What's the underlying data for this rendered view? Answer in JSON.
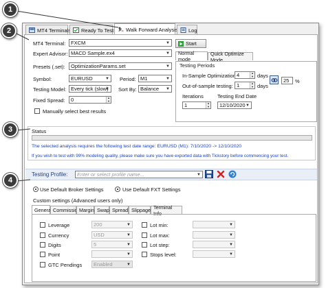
{
  "callouts": [
    "1",
    "2",
    "3",
    "4"
  ],
  "tabs": [
    {
      "label": "MT4 Terminals",
      "icon": "terminal-icon"
    },
    {
      "label": "Ready To Test",
      "icon": "checklist-icon"
    },
    {
      "label": "Walk Forward Analysis",
      "icon": "walk-forward-icon"
    },
    {
      "label": "Log",
      "icon": "log-icon"
    }
  ],
  "settings": {
    "terminal_label": "MT4 Terminal:",
    "terminal_value": "FXCM",
    "ea_label": "Expert Advisor:",
    "ea_value": "MACD Sample.ex4",
    "presets_label": "Presets (.set):",
    "presets_value": "OptimizationParams.set",
    "symbol_label": "Symbol:",
    "symbol_value": "EURUSD",
    "period_label": "Period:",
    "period_value": "M1",
    "model_label": "Testing Model:",
    "model_value": "Every tick (slow)",
    "sortby_label": "Sort By:",
    "sortby_value": "Balance",
    "spread_label": "Fixed Spread:",
    "spread_value": "0",
    "manual_label": "Manually select best results",
    "start_label": "Start"
  },
  "periods": {
    "normal_tab": "Normal mode",
    "quick_tab": "Quick Optimize Mode",
    "group_title": "Testing Periods",
    "insample_label": "In-Sample Optimization:",
    "insample_value": "4",
    "insample_unit": "days",
    "oos_label": "Out-of-sample testing:",
    "oos_value": "1",
    "oos_unit": "days",
    "pct_value": "25",
    "pct_unit": "%",
    "iterations_label": "Iterations",
    "iterations_value": "1",
    "end_label": "Testing End Date",
    "end_value": "12/10/2020"
  },
  "status": {
    "title": "Status",
    "line1": "The selected analysis requires the following test date range: EURUSD (M1): 7/10/2020 -> 12/10/2020",
    "line2": "If you wish to test with 99% modeling quality, please make sure you have exported data with Tickstory before commencing your test."
  },
  "profile": {
    "label": "Testing Profile:",
    "placeholder": "Enter or select profile name..."
  },
  "broker": {
    "default_broker": "Use Default Broker Settings",
    "default_fxt": "Use Default FXT Settings",
    "custom_label": "Custom settings (Advanced users only)"
  },
  "custom_tabs": [
    "General",
    "Commission",
    "Margin",
    "Swap",
    "Spread",
    "Slippage",
    "Terminal Info"
  ],
  "general": {
    "left": [
      {
        "label": "Leverage",
        "value": "200"
      },
      {
        "label": "Currency",
        "value": "USD"
      },
      {
        "label": "Digits",
        "value": "5"
      },
      {
        "label": "Point",
        "value": ""
      },
      {
        "label": "GTC Pendings",
        "value": "Enabled"
      }
    ],
    "right": [
      {
        "label": "Lot min:",
        "value": ""
      },
      {
        "label": "Lot max:",
        "value": ""
      },
      {
        "label": "Lot step:",
        "value": ""
      },
      {
        "label": "Stops level:",
        "value": ""
      }
    ]
  },
  "colors": {
    "status_text": "#1a3fb5",
    "start_green": "#2e9e3a",
    "save_blue": "#1f4fa8",
    "delete_red": "#d42020",
    "section_bg": "#e9eef7"
  }
}
